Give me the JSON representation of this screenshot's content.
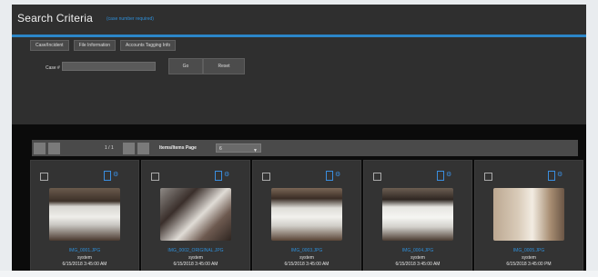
{
  "header": {
    "title": "Search Criteria",
    "subtitle": "(case number required)"
  },
  "tabs": [
    {
      "label": "Case/Incident"
    },
    {
      "label": "File Information"
    },
    {
      "label": "Accounts Tagging Info"
    }
  ],
  "search": {
    "case_label": "Case #",
    "case_value": "",
    "case_placeholder": "",
    "go_label": "Go",
    "reset_label": "Reset"
  },
  "results_toolbar": {
    "pager_text": "1 / 1",
    "items_per_page_label": "Items/Items Page",
    "items_per_page_value": "6"
  },
  "cards": [
    {
      "filename": "IMG_0001.JPG",
      "owner": "system",
      "date": "6/15/2018 3:45:00 AM"
    },
    {
      "filename": "IMG_0002_ORIGINAL.JPG",
      "owner": "system",
      "date": "6/15/2018 3:45:00 AM"
    },
    {
      "filename": "IMG_0003.JPG",
      "owner": "system",
      "date": "6/15/2018 3:45:00 AM"
    },
    {
      "filename": "IMG_0004.JPG",
      "owner": "system",
      "date": "6/15/2018 3:45:00 AM"
    },
    {
      "filename": "IMG_0005.JPG",
      "owner": "system",
      "date": "6/15/2018 3:45:00 PM"
    }
  ],
  "colors": {
    "accent": "#2b86c8",
    "link": "#2f8fd9",
    "panel": "#2f2f2f",
    "band": "#0b0b0b"
  },
  "icons": {
    "card_checkbox": "checkbox-icon",
    "card_copy": "copy-icon",
    "card_options": "options-icon"
  }
}
